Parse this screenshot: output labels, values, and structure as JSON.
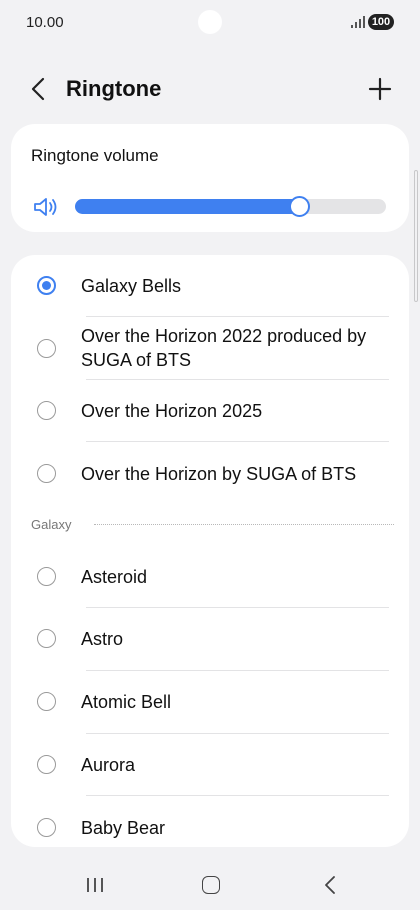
{
  "status_bar": {
    "time": "10.00",
    "battery": "100"
  },
  "header": {
    "title": "Ringtone",
    "back_icon": "chevron-left-icon",
    "add_icon": "plus-icon"
  },
  "volume": {
    "title": "Ringtone volume",
    "icon": "speaker-icon",
    "level": 0.72,
    "accent": "#3f80f0"
  },
  "ringtones": {
    "top_items": [
      {
        "label": "Galaxy Bells",
        "selected": true
      },
      {
        "label": "Over the Horizon 2022 produced by SUGA of BTS",
        "selected": false
      },
      {
        "label": "Over the Horizon 2025",
        "selected": false
      },
      {
        "label": "Over the Horizon by SUGA of BTS",
        "selected": false
      }
    ],
    "section_label": "Galaxy",
    "galaxy_items": [
      {
        "label": "Asteroid",
        "selected": false
      },
      {
        "label": "Astro",
        "selected": false
      },
      {
        "label": "Atomic Bell",
        "selected": false
      },
      {
        "label": "Aurora",
        "selected": false
      },
      {
        "label": "Baby Bear",
        "selected": false
      }
    ]
  },
  "nav": {
    "recents_icon": "recents-icon",
    "home_icon": "home-icon",
    "back_icon": "back-icon"
  }
}
